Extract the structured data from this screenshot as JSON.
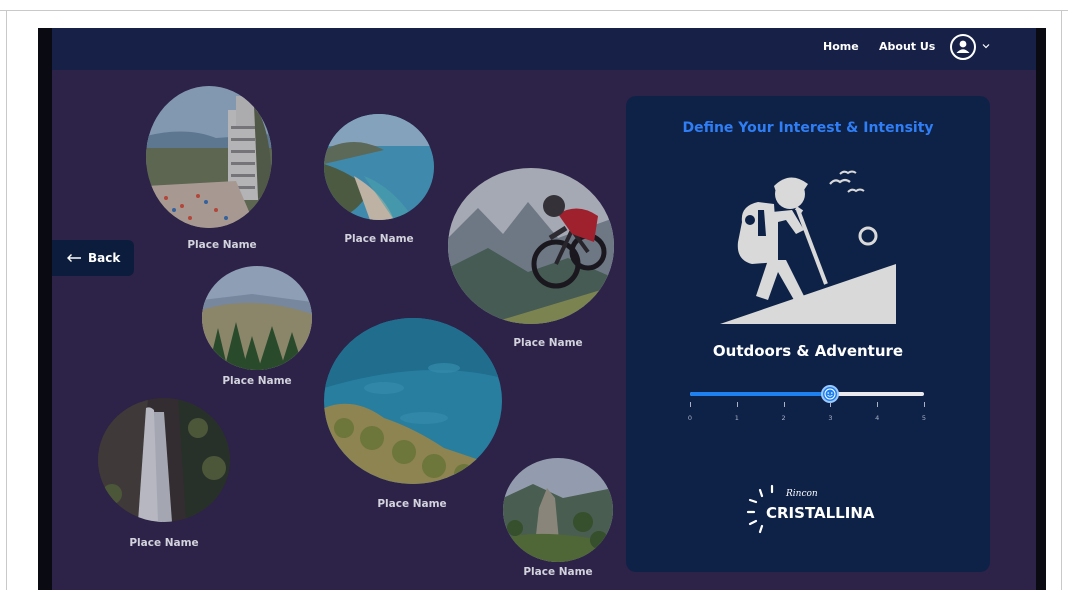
{
  "nav": {
    "home": "Home",
    "about": "About Us"
  },
  "back": {
    "label": "Back"
  },
  "places": [
    {
      "label": "Place Name",
      "scene": "coastal-town"
    },
    {
      "label": "Place Name",
      "scene": "bay"
    },
    {
      "label": "Place Name",
      "scene": "mountain-bike"
    },
    {
      "label": "Place Name",
      "scene": "forest-hills"
    },
    {
      "label": "Place Name",
      "scene": "turquoise-sea"
    },
    {
      "label": "Place Name",
      "scene": "waterfall"
    },
    {
      "label": "Place Name",
      "scene": "rock-valley"
    }
  ],
  "panel": {
    "title": "Define Your Interest & Intensity",
    "icon": "hiker-icon",
    "interest": "Outdoors & Adventure",
    "slider": {
      "min": 0,
      "max": 5,
      "value": 3,
      "ticks": [
        "0",
        "1",
        "2",
        "3",
        "4",
        "5"
      ]
    }
  },
  "logo": {
    "line1": "Rincon",
    "line2": "CRISTALLINA"
  },
  "colors": {
    "app_bg": "#2d2247",
    "topbar": "#172147",
    "panel": "#0e2247",
    "accent": "#2f7ef5"
  }
}
